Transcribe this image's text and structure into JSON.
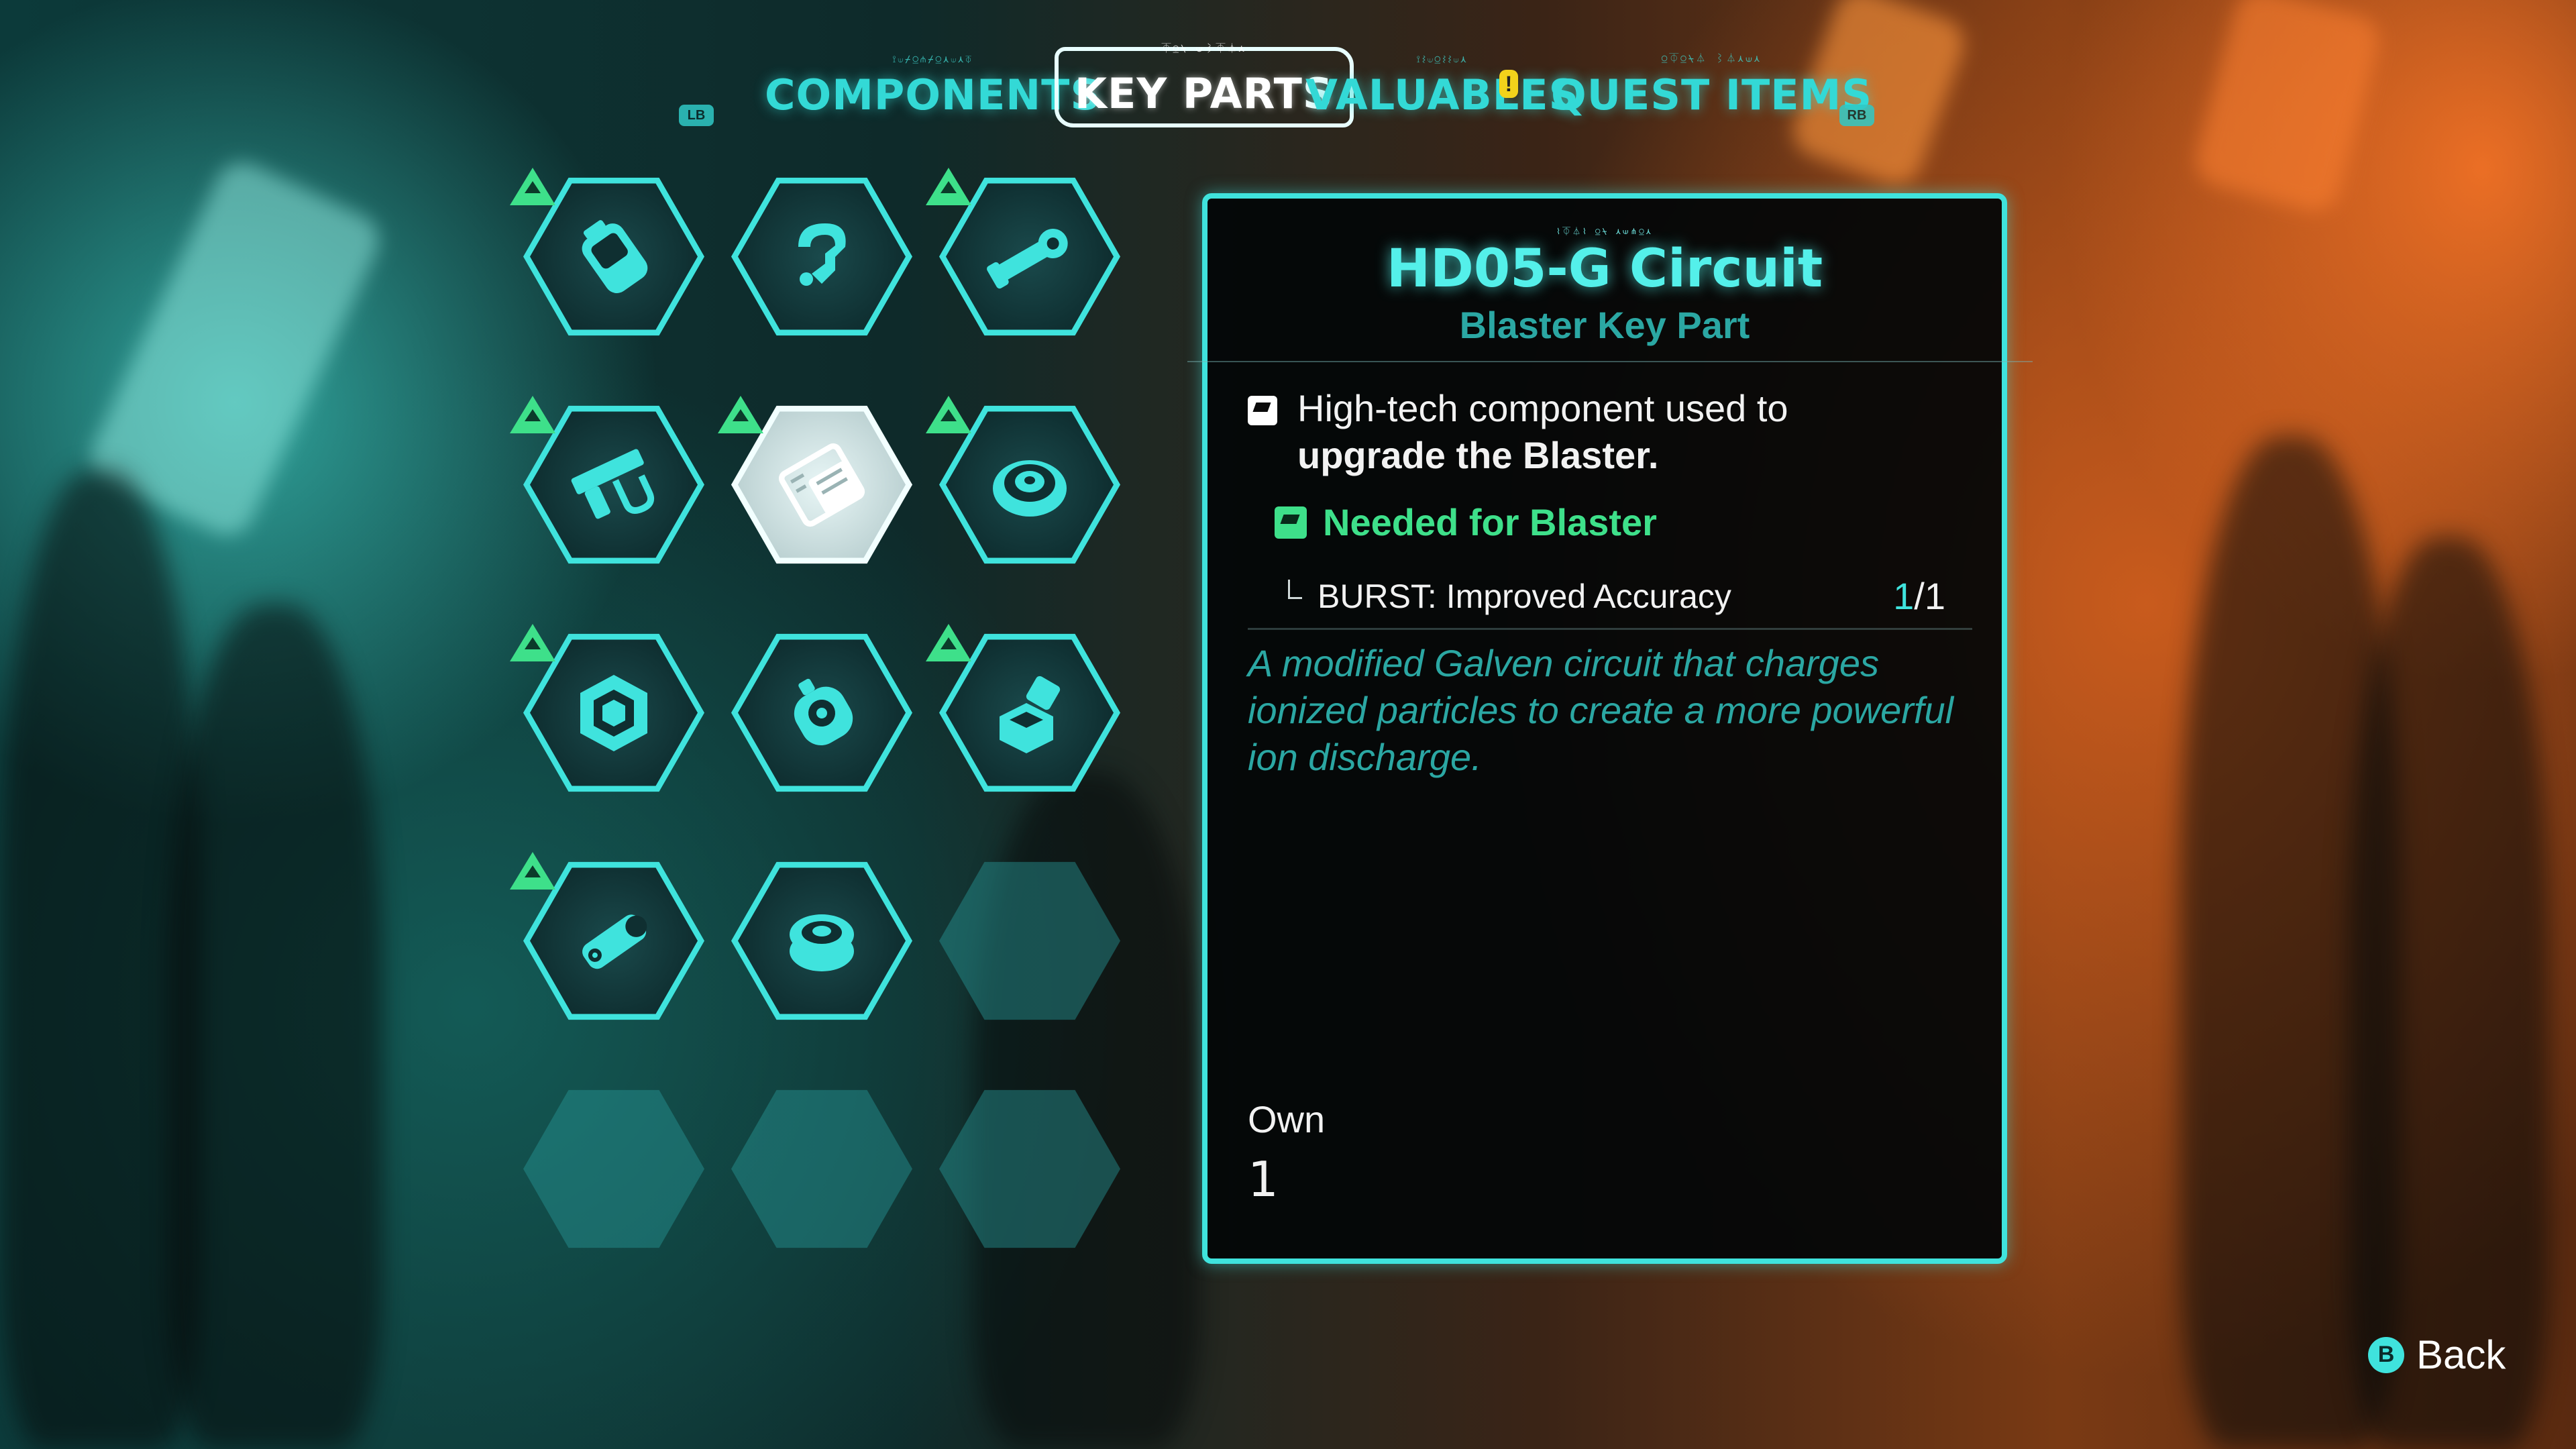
{
  "tabs": {
    "left_bumper": "LB",
    "right_bumper": "RB",
    "items": [
      {
        "label": "COMPONENTS",
        "glyphs": "⟟⟒⌿⍜⋔⌿⍜⋏⟒⋏⏁"
      },
      {
        "label": "KEY PARTS",
        "glyphs": "⏁⍜⍀ ⟒⌇⏁⏃⋏"
      },
      {
        "label": "VALUABLES",
        "glyphs": "⟟⌇⟒⍜⌇⌇⟒⋏"
      },
      {
        "label": "QUEST ITEMS",
        "glyphs": "⍜⏁⍜⍀⏃ ⌇⏃⋏⟒⋏"
      }
    ],
    "active_tab": "KEY PARTS",
    "alert_mark": "!"
  },
  "grid": {
    "cells": [
      {
        "icon": "battery-cell-icon",
        "new": true
      },
      {
        "icon": "hook-clamp-icon",
        "new": false
      },
      {
        "icon": "barrel-tube-icon",
        "new": true
      },
      {
        "icon": "frame-bracket-icon",
        "new": true
      },
      {
        "icon": "circuit-board-icon",
        "new": true,
        "selected": true
      },
      {
        "icon": "coil-spool-icon",
        "new": true
      },
      {
        "icon": "hex-nut-icon",
        "new": true
      },
      {
        "icon": "scope-module-icon",
        "new": false
      },
      {
        "icon": "emitter-block-icon",
        "new": true
      },
      {
        "icon": "capacitor-icon",
        "new": true
      },
      {
        "icon": "gear-coil-icon",
        "new": false
      },
      {
        "icon": "",
        "empty": true
      },
      {
        "icon": "",
        "empty": true
      },
      {
        "icon": "",
        "empty": true
      },
      {
        "icon": "",
        "empty": true
      }
    ]
  },
  "detail": {
    "glyphs": "⌇⏁⏃⌇ ⍜⍀ ⋏⟒⋔⍜⋏",
    "title": "HD05-G Circuit",
    "subtitle": "Blaster Key Part",
    "description_lead": "High-tech component used to",
    "description_bold": "upgrade the Blaster.",
    "needed_label": "Needed for Blaster",
    "upgrade_name": "BURST: Improved Accuracy",
    "upgrade_have": "1",
    "upgrade_sep": "/1",
    "flavor": "A modified Galven circuit that charges ionized particles to create a more powerful ion discharge.",
    "own_label": "Own",
    "own_value": "1"
  },
  "footer": {
    "back_button": "B",
    "back_label": "Back"
  },
  "colors": {
    "accent": "#3fe3dd",
    "new_badge": "#3ee08a",
    "alert": "#f2d21b"
  }
}
